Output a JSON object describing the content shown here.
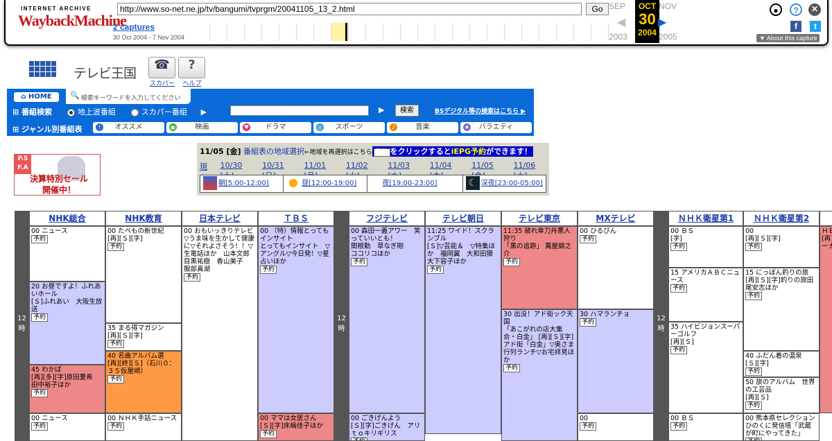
{
  "wayback": {
    "logo_top": "INTERNET ARCHIVE",
    "logo_main": "WaybackMachine",
    "url": "http://www.so-net.ne.jp/tv/bangumi/tvprgm/20041105_13_2.html",
    "go": "Go",
    "captures": "2 captures",
    "range": "30 Oct 2004 - 7 Nov 2004",
    "prev_month": "SEP",
    "cur_month": "OCT",
    "next_month": "NOV",
    "day": "30",
    "prev_year": "2003",
    "cur_year": "2004",
    "next_year": "2005",
    "about": "About this capture"
  },
  "site": {
    "title": "テレビ王国",
    "btn_sky": "スカパー",
    "btn_help": "ヘルプ",
    "home": "HOME",
    "search_hint": "検索キーワードを入力してください",
    "search_label": "番組検索",
    "radio1": "地上波番組",
    "radio2": "スカパー番組",
    "search_btn": "検索",
    "bs_link": "BSデジタル等の検索はこちら",
    "genre_label": "ジャンル別番組表",
    "genres": [
      "オススメ",
      "映画",
      "ドラマ",
      "スポーツ",
      "音楽",
      "バラエティ"
    ]
  },
  "ad": {
    "corner": "P.S\nF.A",
    "line1": "決算特別セール",
    "line2": "開催中！"
  },
  "date": {
    "current": "11/05 [金]",
    "region_link": "番組表の地域選択",
    "region_note": "←地域を再選択はこちら",
    "epg_pre": "予約",
    "epg_text1": "をクリックすると",
    "epg_link": "iEPG予約",
    "epg_text2": "ができます！",
    "days": [
      "現在",
      "10/30 [土]",
      "10/31 [日]",
      "11/01 [月]",
      "11/02 [火]",
      "11/03 [水]",
      "11/04 [木]",
      "11/05 [金]",
      "11/06 [土]"
    ],
    "zones": [
      "朝[5:00-12:00]",
      "昼[12:00-19:00]",
      "夜[19:00-23:00]",
      "深夜[23:00-05:00]"
    ]
  },
  "schedule": {
    "hour": "12\n時",
    "channels": [
      "NHK総合",
      "NHK教育",
      "日本テレビ",
      "ＴＢＳ",
      "フジテレビ",
      "テレビ朝日",
      "テレビ東京",
      "MXテレビ",
      "ＮＨＫ衛星第1",
      "ＮＨＫ衛星第2"
    ],
    "yoyaku": "予約",
    "progs": [
      {
        "t": "00 ニュース"
      },
      {
        "t": "20 お昼ですよ！ふれあいホール\n[Ｓ]ふれあい　大阪生放送"
      },
      {
        "t": "45 わかば\n[再][多][字]原田夏希　田中裕子ほか"
      },
      {
        "t": "00 ニュース"
      },
      {
        "t": "00 たべもの新世紀\n[再][Ｓ][字]"
      },
      {
        "t": "35 まる得マガジン\n[再][Ｓ][字]"
      },
      {
        "t": "40 名曲アルバム選\n[再][終][Ｓ]（石川０：３５仮屋崎）"
      },
      {
        "t": "00 ＮＨＫ手話ニュース"
      },
      {
        "t": "00 おもいッきりテレビ　▽うま味を生かして健康に▽それよさそう！！▽生電話ほか　山本文郎目黒祐樹　香山美子　服部真湖"
      },
      {
        "t": "00 （特）情報とってもインサイト\nとってもインサイト　▽アングル▽今日発！▽星占いほか"
      },
      {
        "t": "00 ママは女医さん\n[Ｓ][字]床嶋佳子ほか"
      },
      {
        "t": "00 森田一義アワー　笑っていいとも！\n関根勤　草なぎ剛　　ココリコほか"
      },
      {
        "t": "00 ごきげんよう\n[Ｓ][字]ごきげん　アリｔｏキリギリス"
      },
      {
        "t": "11:25 ワイド！スクランブル\n[Ｓ]▽芸能＆　▽特集ほか　福岡翼　大和田獏　大下容子ほか"
      },
      {
        "t": "11:35 破れ傘刀舟悪人狩り\n「黒の追跡」 萬屋錦之介"
      },
      {
        "t": "30 出没！アド街ック天国\n「あこがれの店大集合・白金」 [再][Ｓ][字]アド街「白金」▽奥さま行列ランチ▽お宅拝見ほか"
      },
      {
        "t": "00 ひるぴん"
      },
      {
        "t": "30 ハマランチョ"
      },
      {
        "t": "00"
      },
      {
        "t": "00 ＢＳ\n[字]"
      },
      {
        "t": "15 アメリカＡＢＣニュース"
      },
      {
        "t": "35 ハイビジョンスーパーゴルフ\n[再][Ｓ]"
      },
      {
        "t": "00 ＢＳ"
      },
      {
        "t": "00\n[再][Ｓ][字]"
      },
      {
        "t": "15 にっぽん釣りの旅\n[再][Ｓ][字]釣りの旅田尾安志ほか"
      },
      {
        "t": "40 ふだん着の温泉\n[Ｓ][字]"
      },
      {
        "t": "50 旅のアルバム　世界の工芸品\n[再][Ｓ]"
      },
      {
        "t": "00 熊本県セレクション　ひのくに発信塔「武蔵が町にやってきた」"
      },
      {
        "t": "ＨＥ\n[再]\nーナ"
      }
    ]
  }
}
